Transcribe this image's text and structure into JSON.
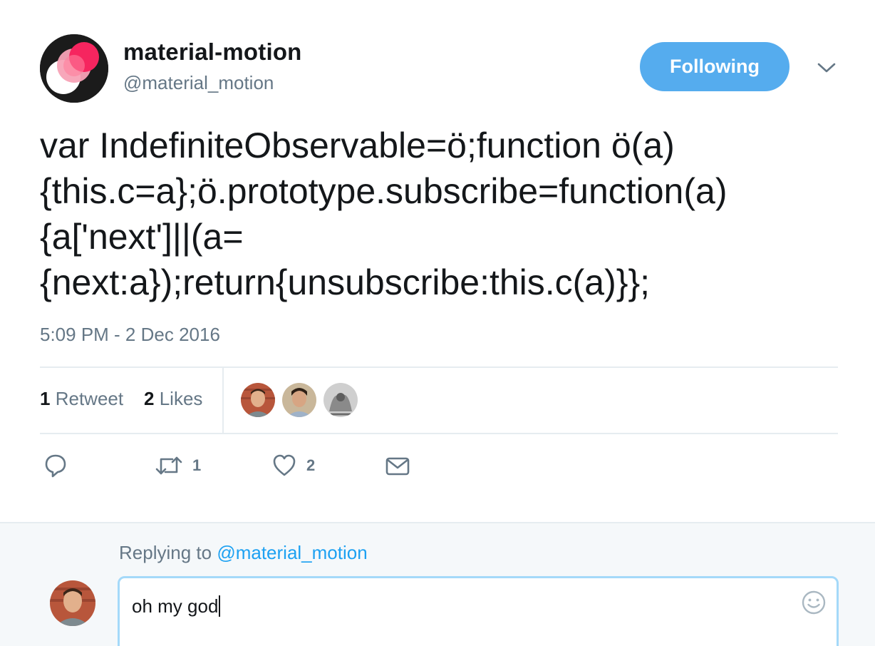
{
  "author": {
    "display_name": "material-motion",
    "handle": "@material_motion"
  },
  "follow_button": {
    "label": "Following"
  },
  "tweet": {
    "text_lines": [
      "var IndefiniteObservable=ö;function ö(a)",
      "{this.c=a};ö.prototype.subscribe=function(a)",
      "{a['next']||(a=",
      "{next:a});return{unsubscribe:this.c(a)}};"
    ],
    "timestamp": "5:09 PM - 2 Dec 2016"
  },
  "stats": {
    "retweets_count": "1",
    "retweets_label": "Retweet",
    "likes_count": "2",
    "likes_label": "Likes"
  },
  "actions": {
    "retweet_count": "1",
    "like_count": "2"
  },
  "reply": {
    "replying_prefix": "Replying to",
    "replying_handle": "@material_motion",
    "input_value": "oh my god"
  },
  "colors": {
    "accent": "#1da1f2",
    "follow_button": "#55acee",
    "secondary_text": "#657786",
    "reply_background": "#f5f8fa"
  },
  "icons": {
    "reply": "reply-icon",
    "retweet": "retweet-icon",
    "like": "heart-icon",
    "message": "envelope-icon",
    "caret": "chevron-down-icon",
    "emoji": "smiley-icon"
  }
}
